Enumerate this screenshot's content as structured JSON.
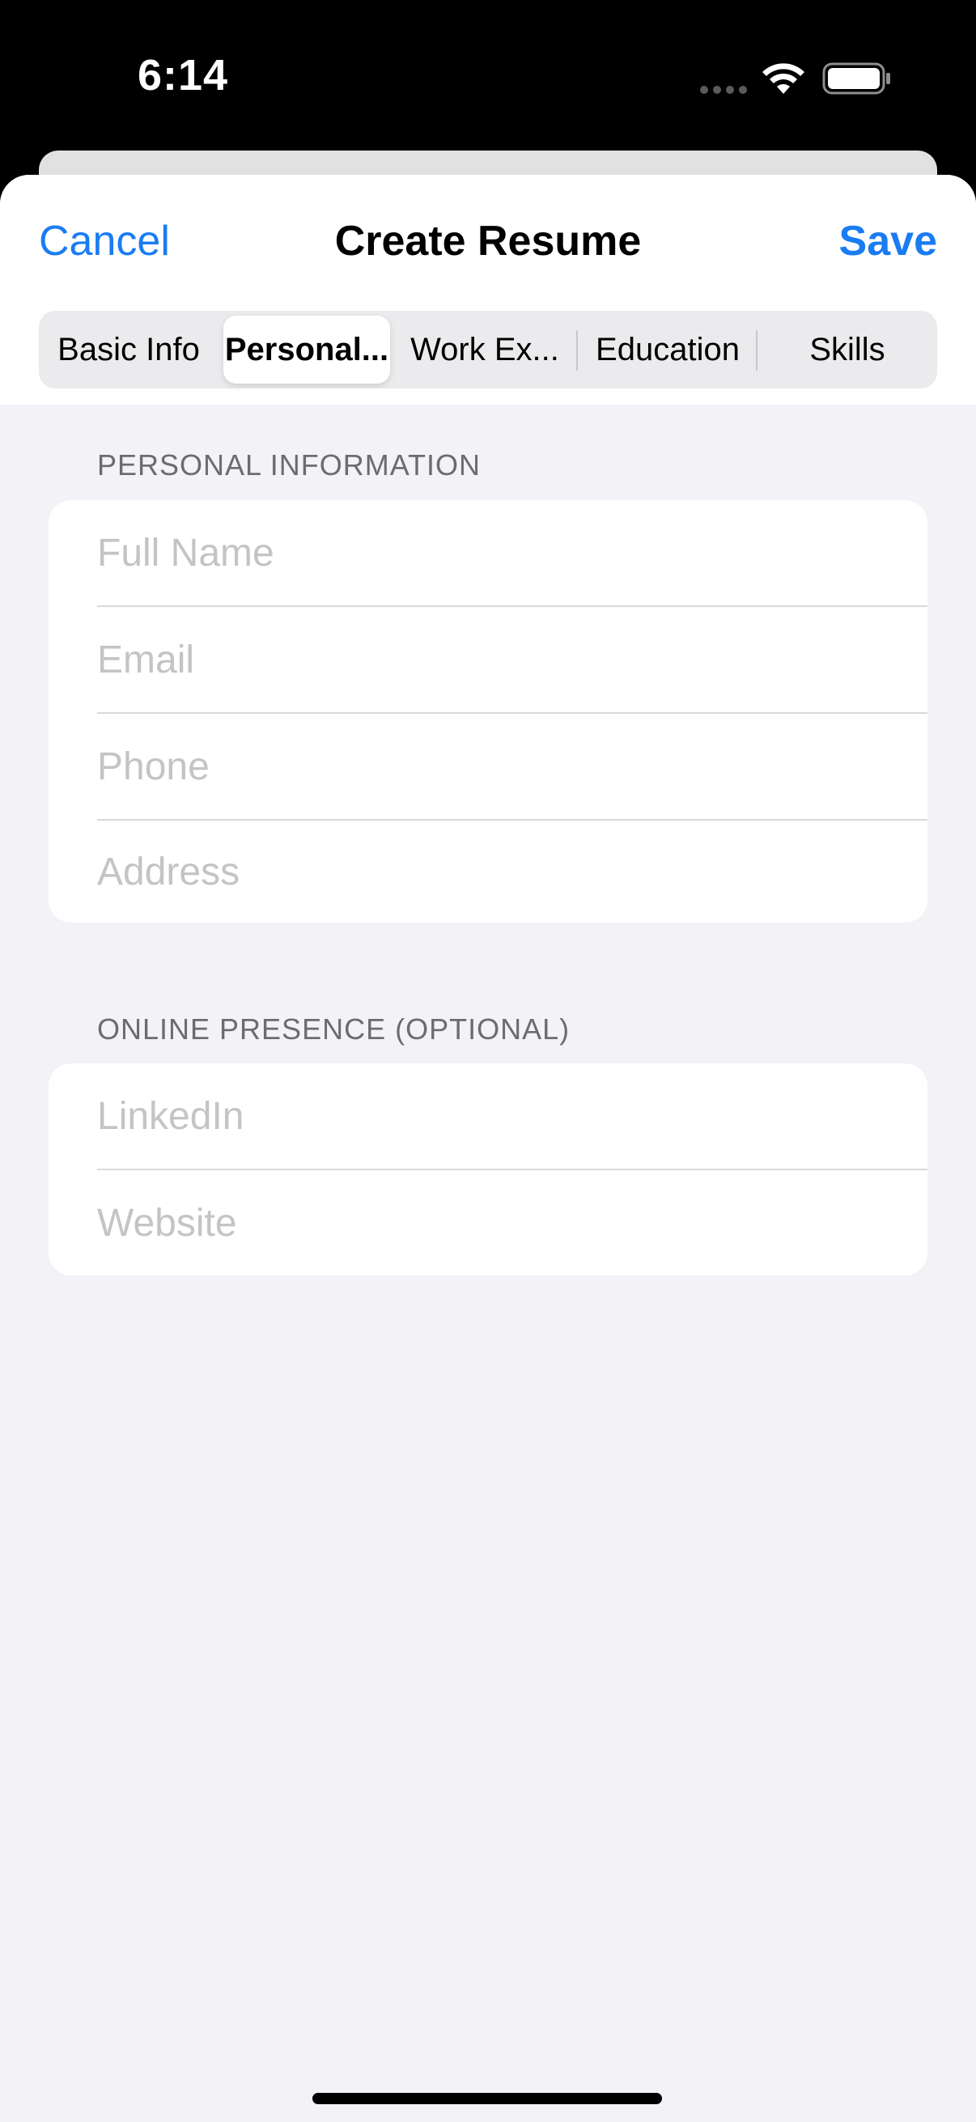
{
  "status_bar": {
    "time": "6:14"
  },
  "header": {
    "cancel_label": "Cancel",
    "title": "Create Resume",
    "save_label": "Save"
  },
  "tabs": [
    {
      "label": "Basic Info",
      "selected": false
    },
    {
      "label": "Personal...",
      "selected": true
    },
    {
      "label": "Work Ex...",
      "selected": false
    },
    {
      "label": "Education",
      "selected": false
    },
    {
      "label": "Skills",
      "selected": false
    }
  ],
  "personal_section": {
    "header": "PERSONAL INFORMATION",
    "fields": [
      {
        "placeholder": "Full Name",
        "value": ""
      },
      {
        "placeholder": "Email",
        "value": ""
      },
      {
        "placeholder": "Phone",
        "value": ""
      },
      {
        "placeholder": "Address",
        "value": ""
      }
    ]
  },
  "online_section": {
    "header": "ONLINE PRESENCE (OPTIONAL)",
    "fields": [
      {
        "placeholder": "LinkedIn",
        "value": ""
      },
      {
        "placeholder": "Website",
        "value": ""
      }
    ]
  },
  "colors": {
    "accent": "#1a7cf2",
    "background": "#f2f2f7",
    "placeholder": "#c4c4c6",
    "section_header": "#6c6c70"
  },
  "icons": {
    "signal": "signal-dots-icon",
    "wifi": "wifi-icon",
    "battery": "battery-icon"
  }
}
